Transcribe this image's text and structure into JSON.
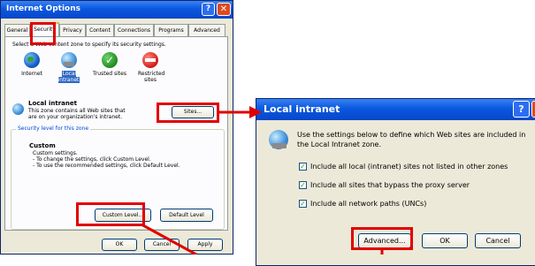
{
  "internet_options": {
    "title": "Internet Options",
    "tabs": [
      "General",
      "Security",
      "Privacy",
      "Content",
      "Connections",
      "Programs",
      "Advanced"
    ],
    "instruction": "Select a Web content zone to specify its security settings.",
    "zones": [
      {
        "label": "Internet",
        "icon": "globe-icon"
      },
      {
        "label": "Local intranet",
        "icon": "intranet-icon"
      },
      {
        "label": "Trusted sites",
        "icon": "checkmark-icon"
      },
      {
        "label": "Restricted sites",
        "icon": "restricted-icon"
      }
    ],
    "zone_heading": "Local intranet",
    "zone_desc_1": "This zone contains all Web sites that",
    "zone_desc_2": "are on your organization's intranet.",
    "sites_button": "Sites...",
    "security_level_label": "Security level for this zone",
    "custom_title": "Custom",
    "custom_line1": "Custom settings.",
    "custom_line2": "- To change the settings, click Custom Level.",
    "custom_line3": "- To use the recommended settings, click Default Level.",
    "custom_level_button": "Custom Level...",
    "default_level_button": "Default Level",
    "ok_button": "OK",
    "cancel_button": "Cancel",
    "apply_button": "Apply"
  },
  "local_intranet": {
    "title": "Local intranet",
    "description_1": "Use the settings below to define which Web sites are included in",
    "description_2": "the Local Intranet zone.",
    "options": [
      {
        "label": "Include all local (intranet) sites not listed in other zones",
        "checked": true
      },
      {
        "label": "Include all sites that bypass the proxy server",
        "checked": true
      },
      {
        "label": "Include all network paths (UNCs)",
        "checked": true
      }
    ],
    "advanced_button": "Advanced...",
    "ok_button": "OK",
    "cancel_button": "Cancel"
  },
  "colors": {
    "highlight": "#e00000",
    "titlebar": "#0a58e0"
  }
}
